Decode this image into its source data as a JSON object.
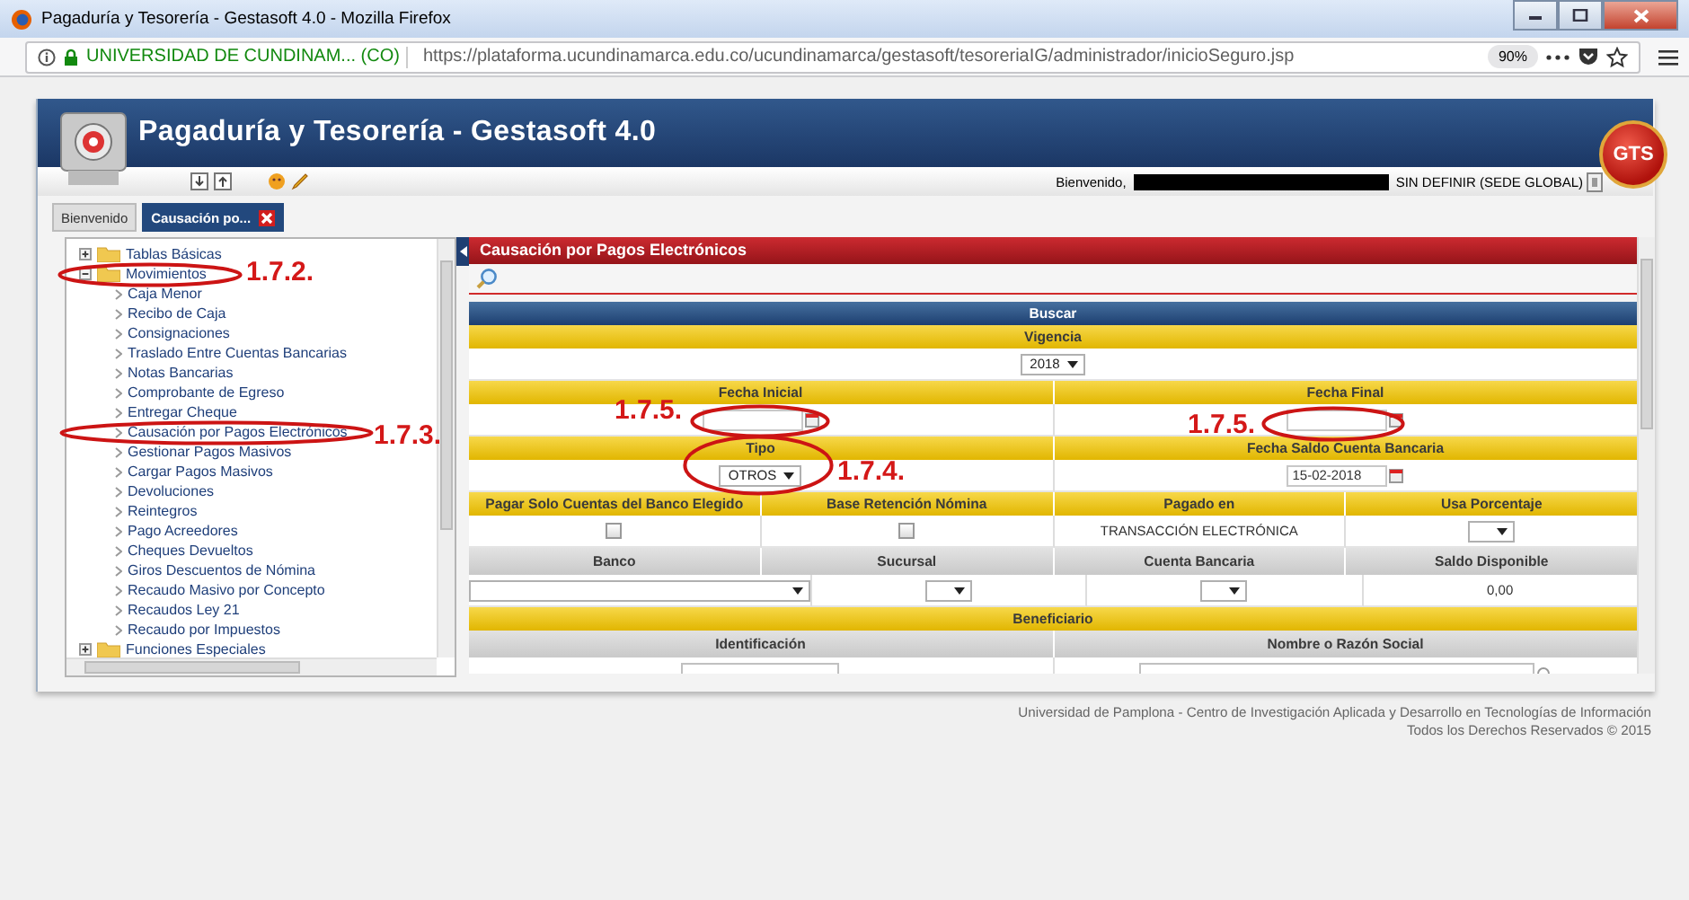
{
  "browser": {
    "title": "Pagaduría y Tesorería - Gestasoft 4.0 - Mozilla Firefox",
    "site": "UNIVERSIDAD DE CUNDINAM... (CO)",
    "url": "https://plataforma.ucundinamarca.edu.co/ucundinamarca/gestasoft/tesoreriaIG/administrador/inicioSeguro.jsp",
    "zoom": "90%"
  },
  "app": {
    "title": "Pagaduría y Tesorería - Gestasoft 4.0",
    "badge": "GTS",
    "welcome": "Bienvenido,",
    "scope": "SIN DEFINIR (SEDE GLOBAL)"
  },
  "tabs": [
    {
      "label": "Bienvenido",
      "selected": false,
      "closable": false
    },
    {
      "label": "Causación po...",
      "selected": true,
      "closable": true
    }
  ],
  "tree": [
    {
      "label": "Tablas Básicas",
      "expanded": false
    },
    {
      "label": "Movimientos",
      "expanded": true,
      "children": [
        {
          "label": "Caja Menor"
        },
        {
          "label": "Recibo de Caja"
        },
        {
          "label": "Consignaciones"
        },
        {
          "label": "Traslado Entre Cuentas Bancarias"
        },
        {
          "label": "Notas Bancarias"
        },
        {
          "label": "Comprobante de Egreso"
        },
        {
          "label": "Entregar Cheque"
        },
        {
          "label": "Causación por Pagos Electrónicos"
        },
        {
          "label": "Gestionar Pagos Masivos"
        },
        {
          "label": "Cargar Pagos Masivos"
        },
        {
          "label": "Devoluciones"
        },
        {
          "label": "Reintegros"
        },
        {
          "label": "Pago Acreedores"
        },
        {
          "label": "Cheques Devueltos"
        },
        {
          "label": "Giros Descuentos de Nómina"
        },
        {
          "label": "Recaudo Masivo por Concepto"
        },
        {
          "label": "Recaudos Ley 21"
        },
        {
          "label": "Recaudo por Impuestos"
        }
      ]
    },
    {
      "label": "Funciones Especiales",
      "expanded": false
    }
  ],
  "panel": {
    "title": "Causación por Pagos Electrónicos",
    "rows": [
      {
        "kind": "title",
        "cells": [
          {
            "label": "Buscar"
          }
        ]
      },
      {
        "kind": "heading",
        "cells": [
          {
            "label": "Vigencia"
          }
        ]
      },
      {
        "kind": "fields",
        "cells": [
          {
            "kind": "select",
            "value": "2018"
          }
        ]
      },
      {
        "kind": "heading",
        "cells": [
          {
            "label": "Fecha Inicial"
          },
          {
            "label": "Fecha Final"
          }
        ]
      },
      {
        "kind": "fields",
        "cells": [
          {
            "kind": "date"
          },
          {
            "kind": "date"
          }
        ]
      },
      {
        "kind": "heading",
        "cells": [
          {
            "label": "Tipo"
          },
          {
            "label": "Fecha Saldo Cuenta Bancaria"
          }
        ]
      },
      {
        "kind": "fields",
        "cells": [
          {
            "kind": "select",
            "value": "OTROS"
          },
          {
            "kind": "date",
            "value": "15-02-2018"
          }
        ]
      },
      {
        "kind": "heading",
        "cells": [
          {
            "label": "Pagar Solo Cuentas del Banco Elegido"
          },
          {
            "label": "Base Retención Nómina"
          },
          {
            "label": "Pagado en"
          },
          {
            "label": "Usa Porcentaje"
          }
        ]
      },
      {
        "kind": "fields",
        "cells": [
          {
            "kind": "checkbox",
            "checked": false
          },
          {
            "kind": "checkbox",
            "checked": false
          },
          {
            "kind": "text",
            "value": "TRANSACCIÓN ELECTRÓNICA"
          },
          {
            "kind": "select"
          }
        ]
      },
      {
        "kind": "subheading",
        "cells": [
          {
            "label": "Banco"
          },
          {
            "label": "Sucursal"
          },
          {
            "label": "Cuenta Bancaria"
          },
          {
            "label": "Saldo Disponible"
          }
        ]
      },
      {
        "kind": "fields",
        "cells": [
          {
            "kind": "combo"
          },
          {
            "kind": "select"
          },
          {
            "kind": "select"
          },
          {
            "kind": "text",
            "value": "0,00"
          }
        ]
      },
      {
        "kind": "heading",
        "cells": [
          {
            "label": "Beneficiario"
          }
        ]
      },
      {
        "kind": "subheading",
        "cells": [
          {
            "label": "Identificación"
          },
          {
            "label": "Nombre o Razón Social"
          }
        ]
      },
      {
        "kind": "fields",
        "cells": [
          {
            "kind": "input"
          },
          {
            "kind": "search"
          }
        ]
      }
    ]
  },
  "footer": [
    "Universidad de Pamplona - Centro de Investigación Aplicada y Desarrollo en Tecnologías de Información",
    "Todos los Derechos Reservados © 2015"
  ],
  "annotations": [
    {
      "label": "1.7.2."
    },
    {
      "label": "1.7.5."
    },
    {
      "label": "1.7.5."
    },
    {
      "label": "1.7.3."
    },
    {
      "label": "1.7.4."
    }
  ]
}
